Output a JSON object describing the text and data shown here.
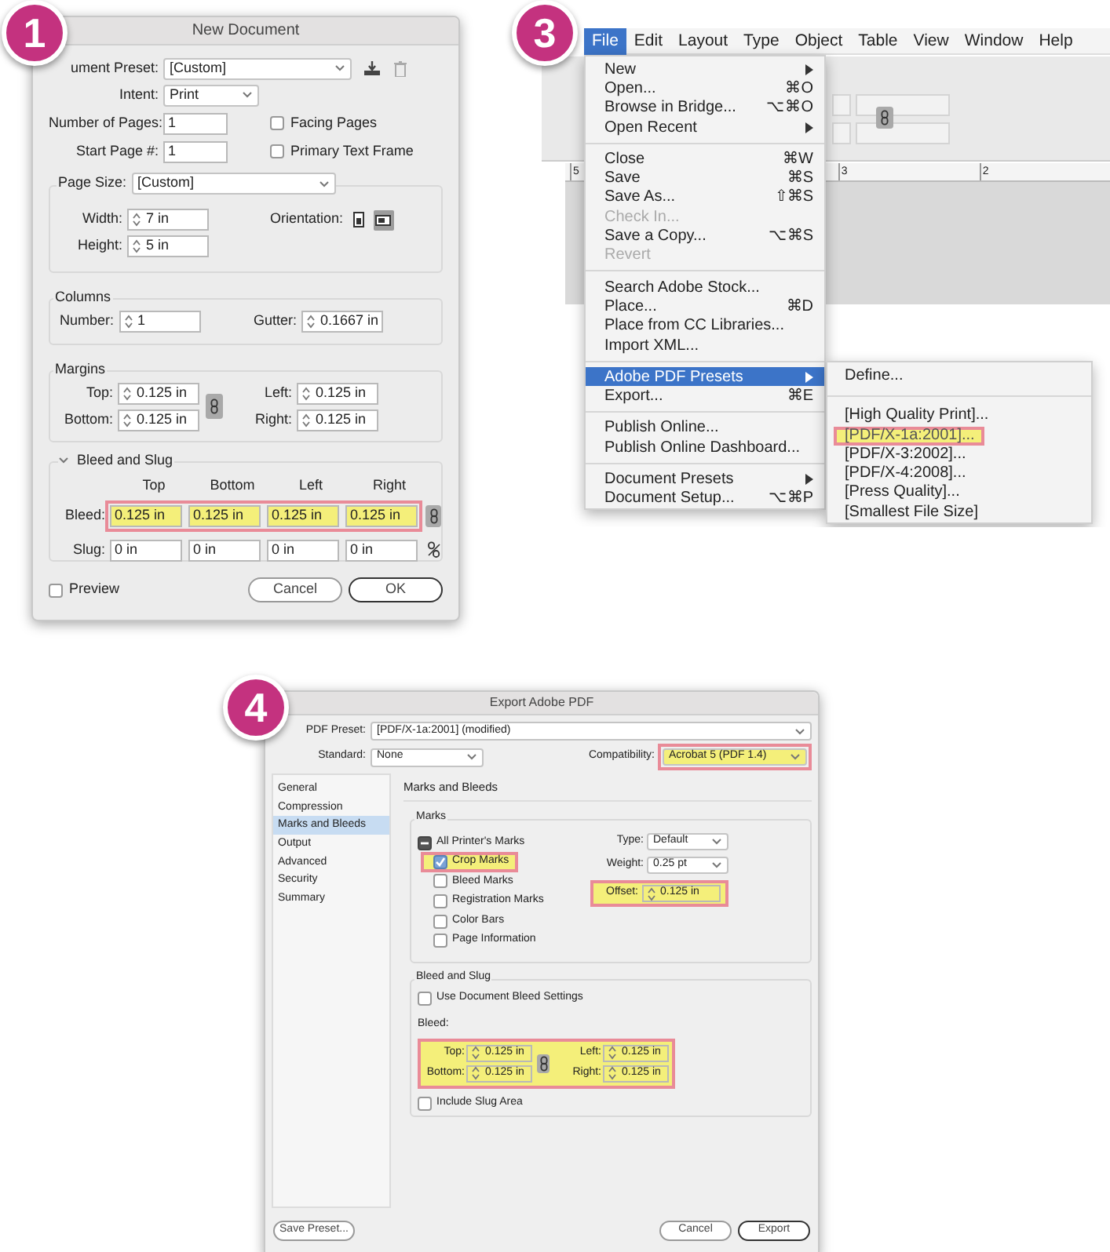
{
  "new_document": {
    "badge": "1",
    "title": "New Document",
    "preset": {
      "label": "ument Preset:",
      "value": "[Custom]"
    },
    "intent": {
      "label": "Intent:",
      "value": "Print"
    },
    "pages": {
      "label": "Number of Pages:",
      "value": "1"
    },
    "start_page": {
      "label": "Start Page #:",
      "value": "1"
    },
    "options": [
      {
        "label": "Facing Pages",
        "checked": false
      },
      {
        "label": "Primary Text Frame",
        "checked": false
      }
    ],
    "page_size": {
      "label": "Page Size:",
      "value": "[Custom]"
    },
    "width": {
      "label": "Width:",
      "value": "7 in"
    },
    "height": {
      "label": "Height:",
      "value": "5 in"
    },
    "orientation": {
      "label": "Orientation:",
      "items": [
        {
          "kind": "portrait",
          "selected": false
        },
        {
          "kind": "landscape",
          "selected": true
        }
      ]
    },
    "columns": {
      "title": "Columns",
      "number": {
        "label": "Number:",
        "value": "1"
      },
      "gutter": {
        "label": "Gutter:",
        "value": "0.1667 in"
      }
    },
    "margins": {
      "title": "Margins",
      "linked": true,
      "fields": [
        {
          "label": "Top:",
          "value": "0.125 in"
        },
        {
          "label": "Left:",
          "value": "0.125 in"
        },
        {
          "label": "Bottom:",
          "value": "0.125 in"
        },
        {
          "label": "Right:",
          "value": "0.125 in"
        }
      ]
    },
    "bleed_slug": {
      "title": "Bleed and Slug",
      "expanded": true,
      "columns": [
        "Top",
        "Bottom",
        "Left",
        "Right"
      ],
      "rows": [
        {
          "label": "Bleed:",
          "values": [
            "0.125 in",
            "0.125 in",
            "0.125 in",
            "0.125 in"
          ],
          "highlighted": true,
          "linked": true
        },
        {
          "label": "Slug:",
          "values": [
            "0 in",
            "0 in",
            "0 in",
            "0 in"
          ],
          "highlighted": false,
          "linked": false
        }
      ]
    },
    "preview": {
      "label": "Preview",
      "checked": false
    },
    "buttons": [
      {
        "label": "Cancel",
        "default": false
      },
      {
        "label": "OK",
        "default": true
      }
    ]
  },
  "file_menu": {
    "badge": "3",
    "menu_bar": [
      {
        "label": "File",
        "selected": true
      },
      {
        "label": "Edit",
        "selected": false
      },
      {
        "label": "Layout",
        "selected": false
      },
      {
        "label": "Type",
        "selected": false
      },
      {
        "label": "Object",
        "selected": false
      },
      {
        "label": "Table",
        "selected": false
      },
      {
        "label": "View",
        "selected": false
      },
      {
        "label": "Window",
        "selected": false
      },
      {
        "label": "Help",
        "selected": false
      }
    ],
    "ruler": [
      "5",
      "3",
      "2"
    ],
    "menu": [
      [
        {
          "label": "New",
          "submenu": true,
          "disabled": false,
          "selected": false
        },
        {
          "label": "Open...",
          "shortcut": "⌘O",
          "submenu": false,
          "disabled": false,
          "selected": false
        },
        {
          "label": "Browse in Bridge...",
          "shortcut": "⌥⌘O",
          "submenu": false,
          "disabled": false,
          "selected": false
        },
        {
          "label": "Open Recent",
          "submenu": true,
          "disabled": false,
          "selected": false
        }
      ],
      [
        {
          "label": "Close",
          "shortcut": "⌘W",
          "submenu": false,
          "disabled": false,
          "selected": false
        },
        {
          "label": "Save",
          "shortcut": "⌘S",
          "submenu": false,
          "disabled": false,
          "selected": false
        },
        {
          "label": "Save As...",
          "shortcut": "⇧⌘S",
          "submenu": false,
          "disabled": false,
          "selected": false
        },
        {
          "label": "Check In...",
          "submenu": false,
          "disabled": true,
          "selected": false
        },
        {
          "label": "Save a Copy...",
          "shortcut": "⌥⌘S",
          "submenu": false,
          "disabled": false,
          "selected": false
        },
        {
          "label": "Revert",
          "submenu": false,
          "disabled": true,
          "selected": false
        }
      ],
      [
        {
          "label": "Search Adobe Stock...",
          "submenu": false,
          "disabled": false,
          "selected": false
        },
        {
          "label": "Place...",
          "shortcut": "⌘D",
          "submenu": false,
          "disabled": false,
          "selected": false
        },
        {
          "label": "Place from CC Libraries...",
          "submenu": false,
          "disabled": false,
          "selected": false
        },
        {
          "label": "Import XML...",
          "submenu": false,
          "disabled": false,
          "selected": false
        }
      ],
      [
        {
          "label": "Adobe PDF Presets",
          "submenu": true,
          "disabled": false,
          "selected": true
        },
        {
          "label": "Export...",
          "shortcut": "⌘E",
          "submenu": false,
          "disabled": false,
          "selected": false
        }
      ],
      [
        {
          "label": "Publish Online...",
          "submenu": false,
          "disabled": false,
          "selected": false
        },
        {
          "label": "Publish Online Dashboard...",
          "submenu": false,
          "disabled": false,
          "selected": false
        }
      ],
      [
        {
          "label": "Document Presets",
          "submenu": true,
          "disabled": false,
          "selected": false
        },
        {
          "label": "Document Setup...",
          "shortcut": "⌥⌘P",
          "submenu": false,
          "disabled": false,
          "selected": false
        }
      ]
    ],
    "submenu": [
      [
        {
          "label": "Define...",
          "highlighted": false
        }
      ],
      [
        {
          "label": "[High Quality Print]...",
          "highlighted": false
        },
        {
          "label": "[PDF/X-1a:2001]...",
          "highlighted": true
        },
        {
          "label": "[PDF/X-3:2002]...",
          "highlighted": false
        },
        {
          "label": "[PDF/X-4:2008]...",
          "highlighted": false
        },
        {
          "label": "[Press Quality]...",
          "highlighted": false
        },
        {
          "label": "[Smallest File Size]",
          "highlighted": false
        }
      ]
    ]
  },
  "export_pdf": {
    "badge": "4",
    "title": "Export Adobe PDF",
    "preset": {
      "label": "PDF Preset:",
      "value": "[PDF/X-1a:2001] (modified)"
    },
    "standard": {
      "label": "Standard:",
      "value": "None"
    },
    "compatibility": {
      "label": "Compatibility:",
      "value": "Acrobat 5 (PDF 1.4)",
      "highlighted": true
    },
    "sidebar": [
      {
        "label": "General",
        "selected": false
      },
      {
        "label": "Compression",
        "selected": false
      },
      {
        "label": "Marks and Bleeds",
        "selected": true
      },
      {
        "label": "Output",
        "selected": false
      },
      {
        "label": "Advanced",
        "selected": false
      },
      {
        "label": "Security",
        "selected": false
      },
      {
        "label": "Summary",
        "selected": false
      }
    ],
    "section_title": "Marks and Bleeds",
    "marks": {
      "title": "Marks",
      "all": {
        "label": "All Printer's Marks",
        "mixed": true
      },
      "items": [
        {
          "label": "Crop Marks",
          "checked": true,
          "highlighted": true
        },
        {
          "label": "Bleed Marks",
          "checked": false,
          "highlighted": false
        },
        {
          "label": "Registration Marks",
          "checked": false,
          "highlighted": false
        },
        {
          "label": "Color Bars",
          "checked": false,
          "highlighted": false
        },
        {
          "label": "Page Information",
          "checked": false,
          "highlighted": false
        }
      ],
      "type": {
        "label": "Type:",
        "value": "Default"
      },
      "weight": {
        "label": "Weight:",
        "value": "0.25 pt"
      },
      "offset": {
        "label": "Offset:",
        "value": "0.125 in",
        "highlighted": true
      }
    },
    "bleed_slug": {
      "title": "Bleed and Slug",
      "use_document": {
        "label": "Use Document Bleed Settings",
        "checked": false
      },
      "bleed_label": "Bleed:",
      "highlighted": true,
      "linked": true,
      "fields": [
        {
          "label": "Top:",
          "value": "0.125 in"
        },
        {
          "label": "Left:",
          "value": "0.125 in"
        },
        {
          "label": "Bottom:",
          "value": "0.125 in"
        },
        {
          "label": "Right:",
          "value": "0.125 in"
        }
      ],
      "include_slug": {
        "label": "Include Slug Area",
        "checked": false
      }
    },
    "buttons": [
      {
        "label": "Save Preset...",
        "kind": "secondary"
      },
      {
        "label": "Cancel",
        "kind": "normal"
      },
      {
        "label": "Export",
        "kind": "default"
      }
    ]
  }
}
